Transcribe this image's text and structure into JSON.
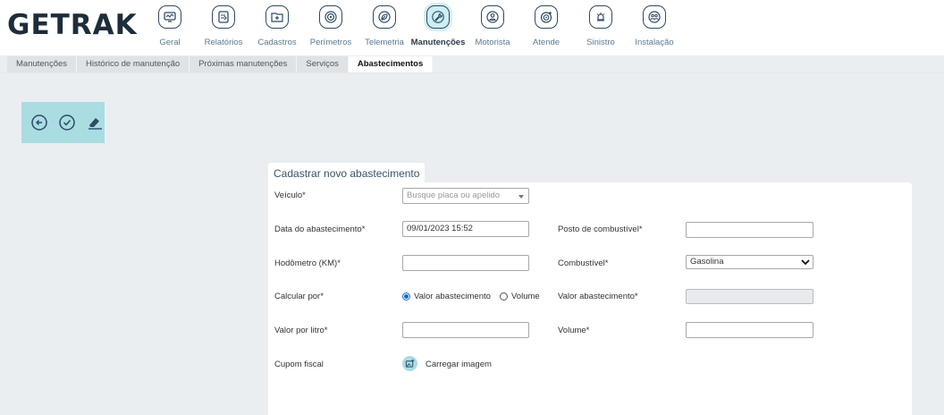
{
  "brand": {
    "logo_text": "GETRAK"
  },
  "nav": [
    {
      "label": "Geral",
      "icon": "monitor-icon"
    },
    {
      "label": "Relatórios",
      "icon": "report-icon"
    },
    {
      "label": "Cadastros",
      "icon": "folder-plus-icon"
    },
    {
      "label": "Perímetros",
      "icon": "target-icon"
    },
    {
      "label": "Telemetria",
      "icon": "leaf-icon"
    },
    {
      "label": "Manutenções",
      "icon": "wrench-icon",
      "active": true
    },
    {
      "label": "Motorista",
      "icon": "person-icon"
    },
    {
      "label": "Atende",
      "icon": "headset-target-icon"
    },
    {
      "label": "Sinistro",
      "icon": "siren-icon"
    },
    {
      "label": "Instalação",
      "icon": "installer-icon"
    }
  ],
  "tabs": [
    {
      "label": "Manutenções"
    },
    {
      "label": "Histórico de manutenção"
    },
    {
      "label": "Próximas manutenções"
    },
    {
      "label": "Serviços"
    },
    {
      "label": "Abastecimentos",
      "active": true
    }
  ],
  "toolbar": {
    "back": "back-icon",
    "confirm": "check-icon",
    "clear": "eraser-icon"
  },
  "form": {
    "title": "Cadastrar novo abastecimento",
    "veiculo_label": "Veículo*",
    "veiculo_placeholder": "Busque placa ou apelido",
    "data_label": "Data do abastecimento*",
    "data_value": "09/01/2023 15:52",
    "posto_label": "Posto de combustível*",
    "posto_value": "",
    "hodometro_label": "Hodômetro (KM)*",
    "hodometro_value": "",
    "combustivel_label": "Combustível*",
    "combustivel_value": "Gasolina",
    "calcular_label": "Calcular por*",
    "radio_valor": "Valor abastecimento",
    "radio_volume": "Volume",
    "calcular_selected": "Valor abastecimento",
    "valor_abast_label": "Valor abastecimento*",
    "valor_abast_value": "",
    "valor_litro_label": "Valor por litro*",
    "valor_litro_value": "",
    "volume_label": "Volume*",
    "volume_value": "",
    "cupom_label": "Cupom fiscal",
    "upload_label": "Carregar imagem"
  },
  "colors": {
    "accent": "#a9dde2",
    "navy": "#2e4a66",
    "background": "#eaeef1"
  }
}
